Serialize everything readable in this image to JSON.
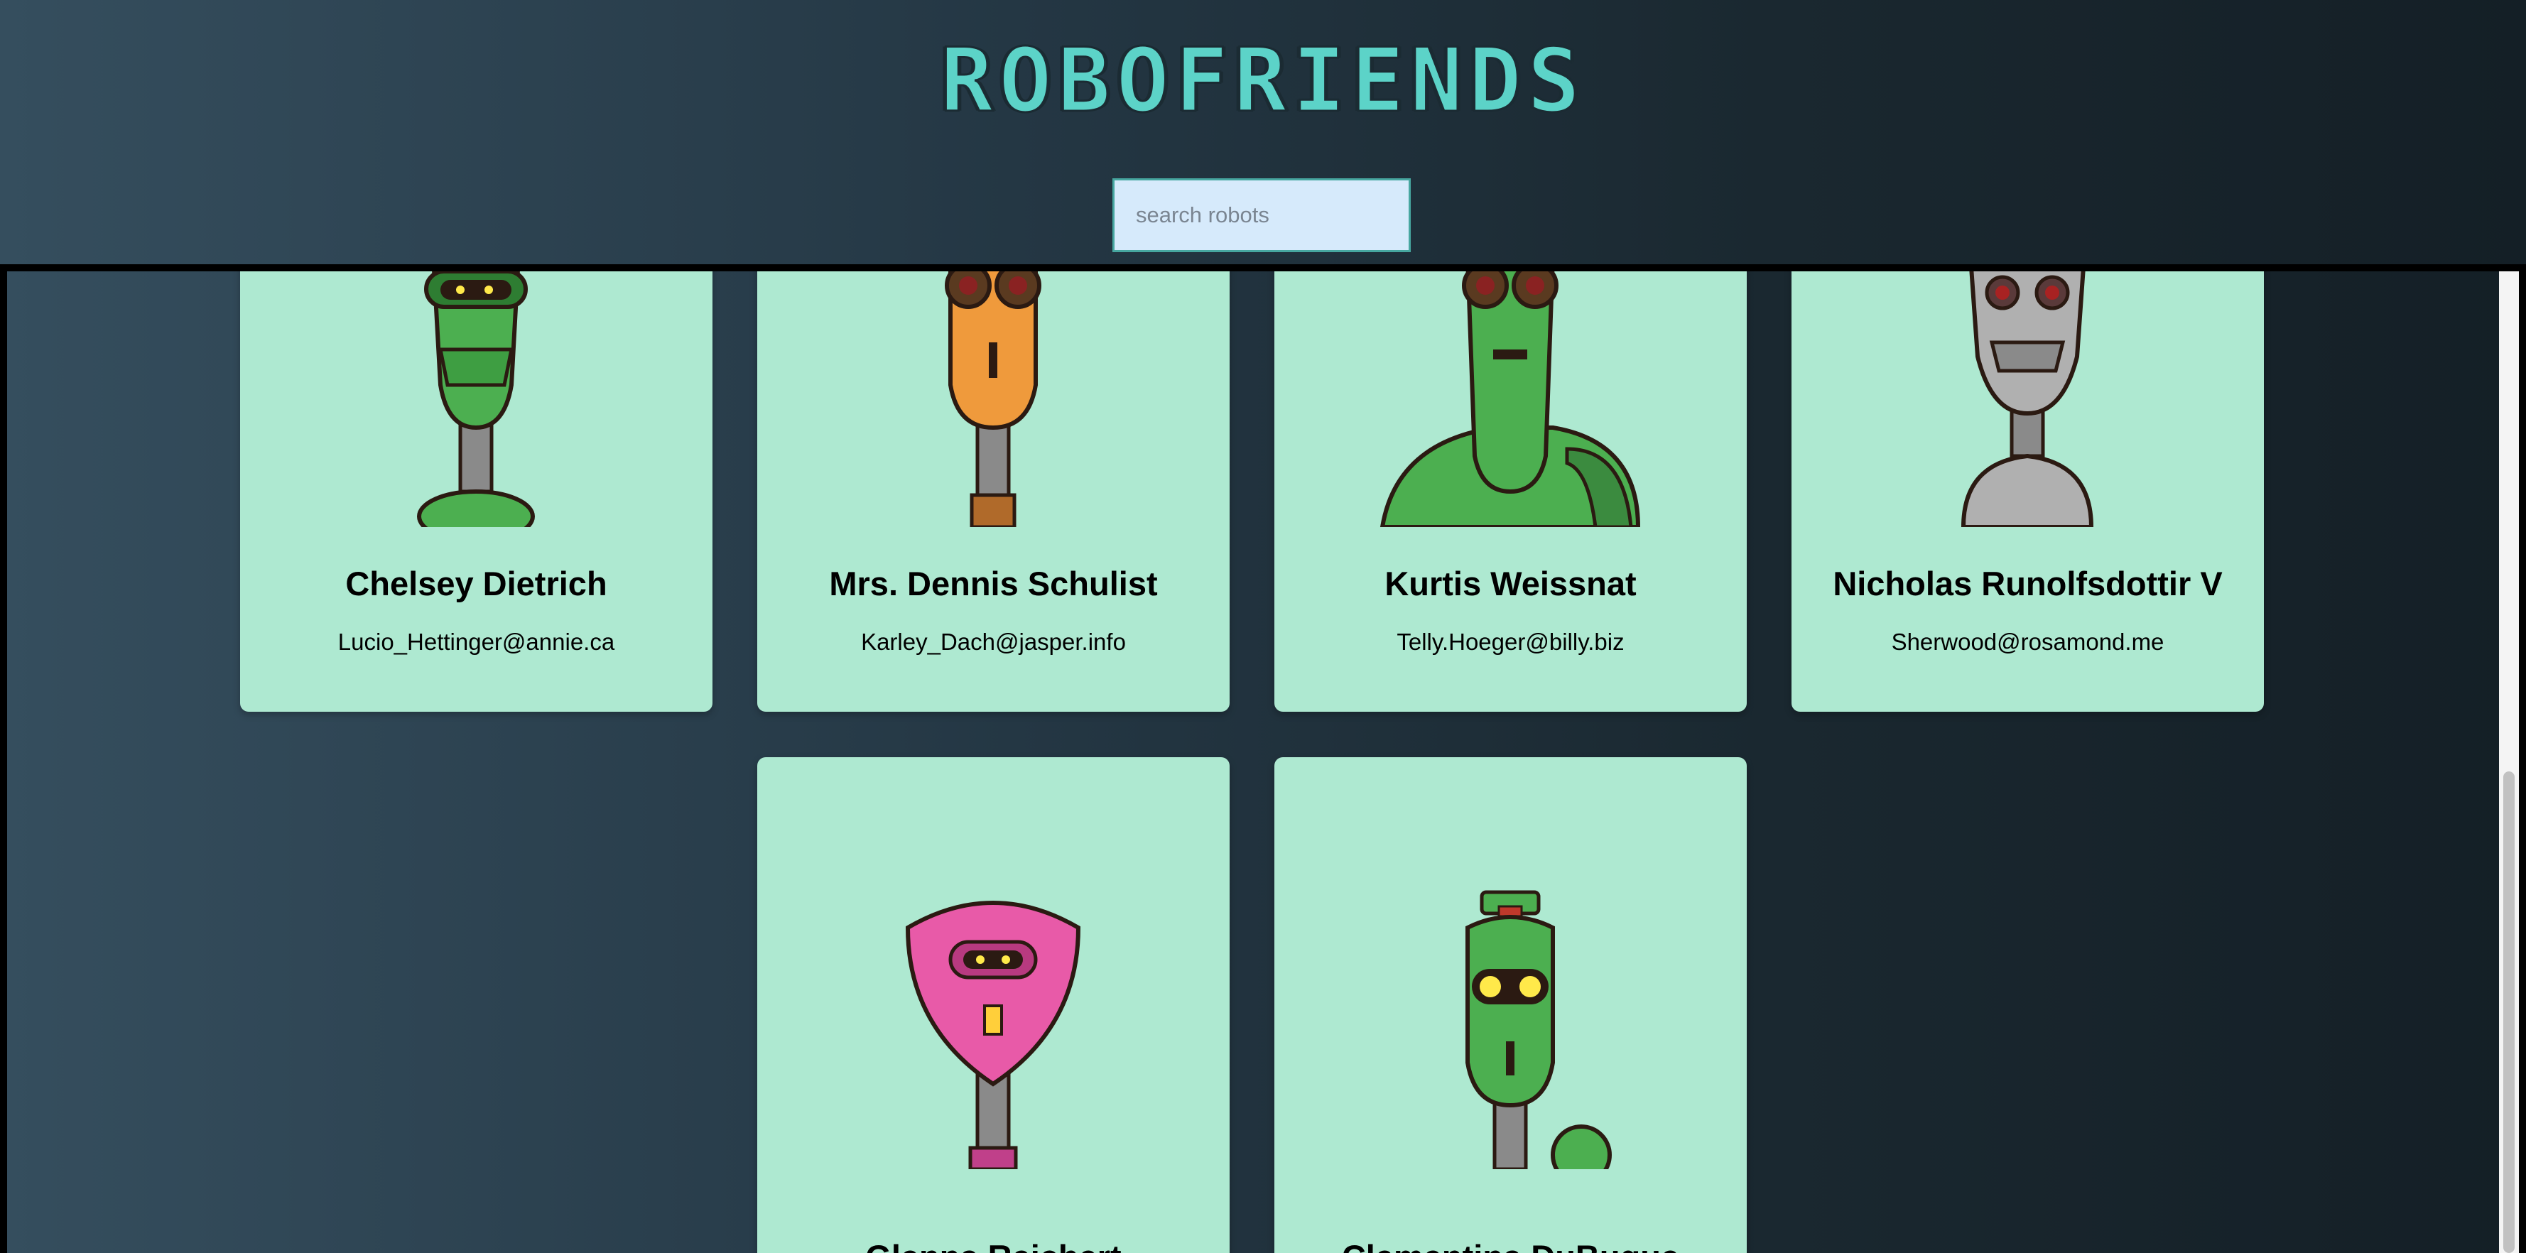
{
  "header": {
    "title": "ROBOFRIENDS",
    "search_placeholder": "search robots"
  },
  "robots": [
    {
      "name": "Chelsey Dietrich",
      "email": "Lucio_Hettinger@annie.ca",
      "color": "#4caf50"
    },
    {
      "name": "Mrs. Dennis Schulist",
      "email": "Karley_Dach@jasper.info",
      "color": "#ef9a3c"
    },
    {
      "name": "Kurtis Weissnat",
      "email": "Telly.Hoeger@billy.biz",
      "color": "#4caf50"
    },
    {
      "name": "Nicholas Runolfsdottir V",
      "email": "Sherwood@rosamond.me",
      "color": "#b0b0b0"
    },
    {
      "name": "Glenna Reichert",
      "email": "",
      "color": "#e85aa8"
    },
    {
      "name": "Clementina DuBuque",
      "email": "",
      "color": "#4caf50"
    }
  ],
  "colors": {
    "card_background": "#aee9d1",
    "title_color": "#5cd3c8",
    "search_background": "#d6eafb"
  }
}
